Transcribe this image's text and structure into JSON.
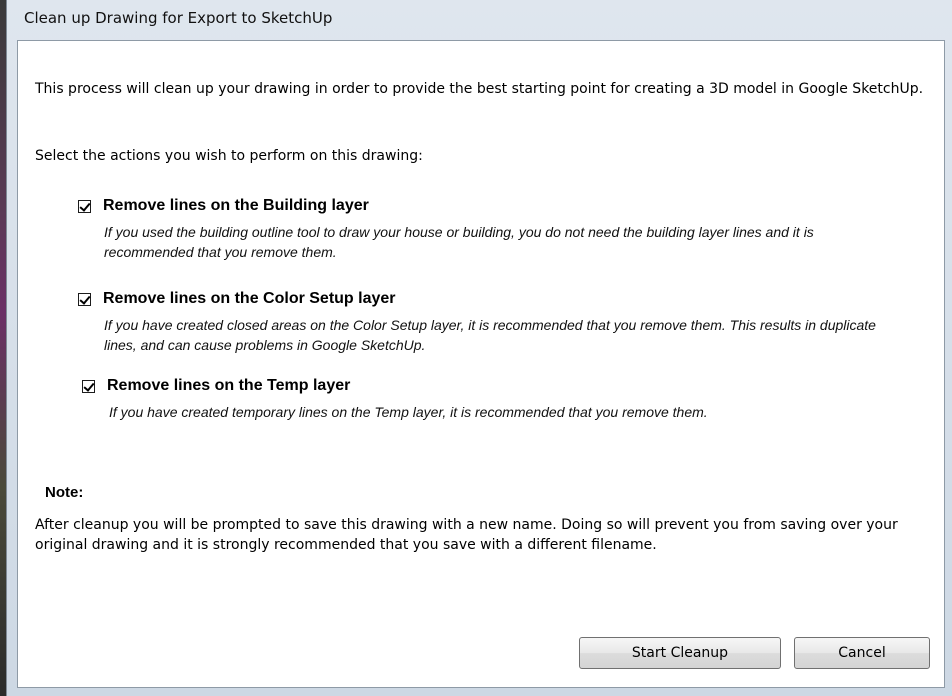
{
  "window": {
    "title": "Clean up Drawing for Export to SketchUp"
  },
  "intro": {
    "text": "This process will clean up your drawing in order to provide the best starting point for creating a 3D model in Google SketchUp."
  },
  "select_label": "Select the actions you wish to perform on this drawing:",
  "options": [
    {
      "label": "Remove lines on the Building layer",
      "checked": true,
      "description": "If you used the building outline tool to draw your house or building, you do not need the building layer lines and it is recommended that you remove them."
    },
    {
      "label": "Remove lines on the Color Setup layer",
      "checked": true,
      "description": "If you have created closed areas on the Color Setup layer, it is recommended that you remove them.  This results in duplicate lines, and can cause problems in Google SketchUp."
    },
    {
      "label": "Remove lines on the Temp layer",
      "checked": true,
      "description": "If you have created temporary lines on the Temp layer, it is recommended that you remove them."
    }
  ],
  "note": {
    "heading": "Note:",
    "text": "After cleanup you will be prompted to save this drawing with a new name.  Doing so will prevent you from saving over your original drawing and it is strongly recommended that you save with a different filename."
  },
  "buttons": {
    "start_label": "Start Cleanup",
    "cancel_label": "Cancel"
  }
}
